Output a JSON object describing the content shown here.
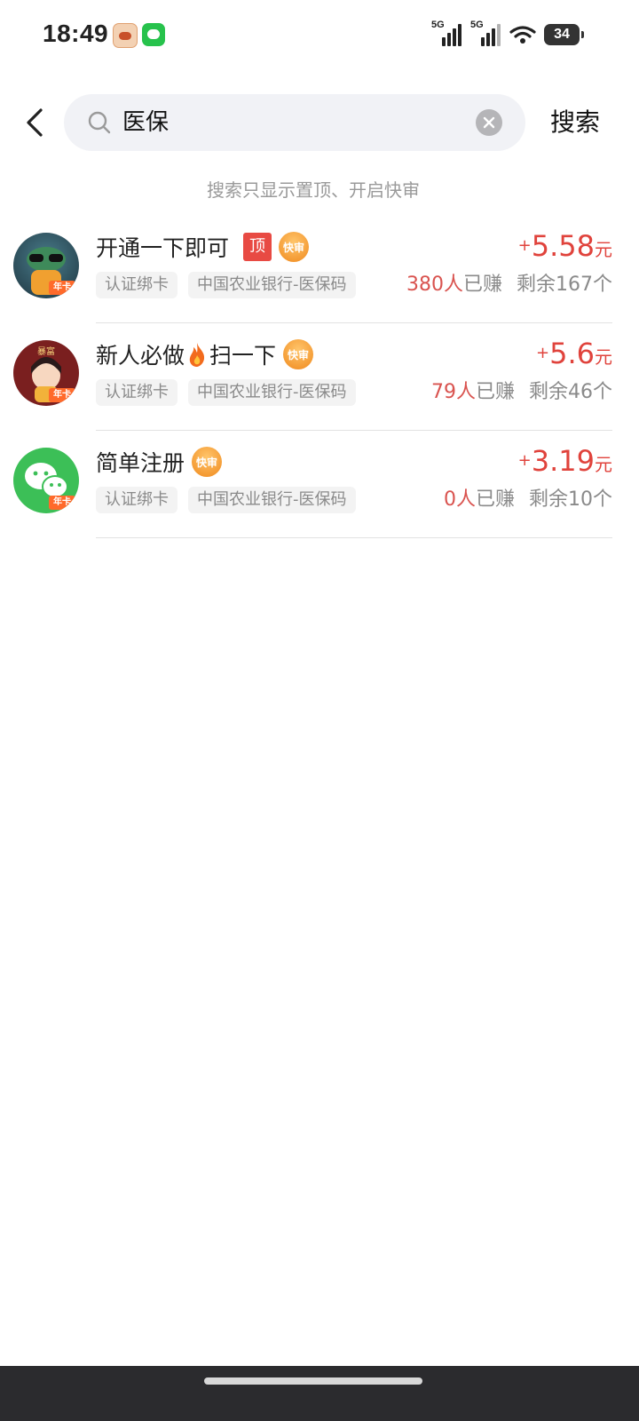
{
  "status_bar": {
    "time": "18:49",
    "signal1": "5G",
    "signal2": "5G",
    "battery": "34"
  },
  "search": {
    "query": "医保",
    "button_label": "搜索"
  },
  "hint": "搜索只显示置顶、开启快审",
  "badge_label": "年卡",
  "top_tag": "顶",
  "fast_tag": "快审",
  "tasks": [
    {
      "title": "开通一下即可",
      "plus": "+",
      "amount": "5.58",
      "unit": "元",
      "tags": [
        "认证绑卡",
        "中国农业银行-医保码"
      ],
      "earned_count": "380人",
      "earned_label": "已赚",
      "remaining": "剩余167个"
    },
    {
      "title_part1": "新人必做",
      "title_part2": "扫一下",
      "plus": "+",
      "amount": "5.6",
      "unit": "元",
      "tags": [
        "认证绑卡",
        "中国农业银行-医保码"
      ],
      "earned_count": "79人",
      "earned_label": "已赚",
      "remaining": "剩余46个"
    },
    {
      "title": "简单注册",
      "plus": "+",
      "amount": "3.19",
      "unit": "元",
      "tags": [
        "认证绑卡",
        "中国农业银行-医保码"
      ],
      "earned_count": "0人",
      "earned_label": "已赚",
      "remaining": "剩余10个"
    }
  ],
  "colors": {
    "price_red": "#e0433c",
    "top_tag_red": "#e84a43",
    "fast_tag_orange": "#f08a1e",
    "wechat_green": "#3cbf57"
  }
}
